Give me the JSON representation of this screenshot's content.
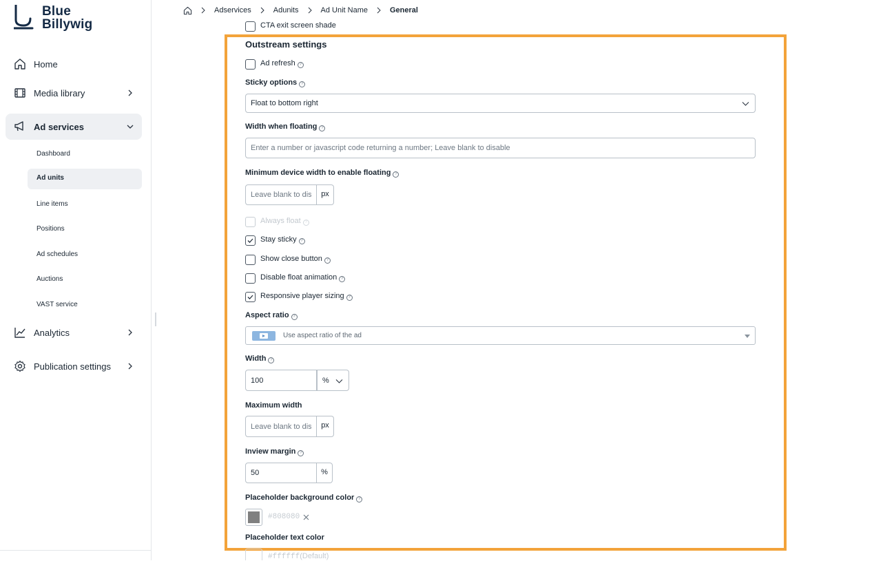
{
  "brand": {
    "line1": "Blue",
    "line2": "Billywig",
    "color": "#142a45"
  },
  "sidebar": {
    "items": [
      {
        "label": "Home",
        "icon": "home-icon"
      },
      {
        "label": "Media library",
        "icon": "film-icon"
      },
      {
        "label": "Ad services",
        "icon": "megaphone-icon"
      },
      {
        "label": "Analytics",
        "icon": "chart-line-icon"
      },
      {
        "label": "Publication settings",
        "icon": "gear-icon"
      }
    ],
    "sub_items": [
      "Dashboard",
      "Ad units",
      "Line items",
      "Positions",
      "Ad schedules",
      "Auctions",
      "VAST service"
    ]
  },
  "breadcrumb": {
    "items": [
      "Adservices",
      "Adunits",
      "Ad Unit Name"
    ],
    "current": "General"
  },
  "form": {
    "top_checkbox": "CTA exit screen shade",
    "section_title": "Outstream settings",
    "ad_refresh": "Ad refresh",
    "sticky_options": {
      "label": "Sticky options",
      "value": "Float to bottom right"
    },
    "width_when_floating": {
      "label": "Width when floating",
      "placeholder": "Enter a number or javascript code returning a number; Leave blank to disable"
    },
    "min_device_width": {
      "label": "Minimum device width to enable floating",
      "placeholder": "Leave blank to disable",
      "unit": "px"
    },
    "always_float": "Always float",
    "stay_sticky": "Stay sticky",
    "show_close_button": "Show close button",
    "disable_float_animation": "Disable float animation",
    "responsive_player_sizing": "Responsive player sizing",
    "aspect_ratio": {
      "label": "Aspect ratio",
      "value": "Use aspect ratio of the ad"
    },
    "width": {
      "label": "Width",
      "value": "100",
      "unit": "%"
    },
    "max_width": {
      "label": "Maximum width",
      "placeholder": "Leave blank to disable",
      "unit": "px"
    },
    "inview_margin": {
      "label": "Inview margin",
      "value": "50",
      "unit": "%"
    },
    "placeholder_bg": {
      "label": "Placeholder background color",
      "value": "#808080",
      "swatch": "#808080"
    },
    "placeholder_text": {
      "label": "Placeholder text color",
      "value": "#ffffff",
      "suffix": "(Default)"
    },
    "checked": {
      "stay_sticky": true,
      "responsive_player_sizing": true
    }
  },
  "colors": {
    "highlight": "#f3a33a",
    "active_bg": "#eef0f3"
  }
}
